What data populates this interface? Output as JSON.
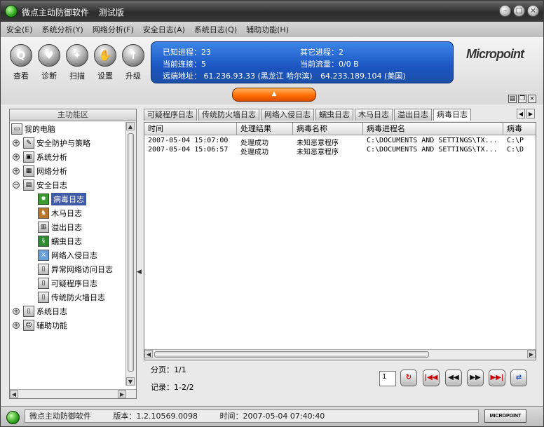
{
  "title": {
    "app": "微点主动防御软件",
    "edition": "测试版"
  },
  "menu": [
    {
      "label": "安全(E)"
    },
    {
      "label": "系统分析(Y)"
    },
    {
      "label": "网络分析(F)"
    },
    {
      "label": "安全日志(A)"
    },
    {
      "label": "系统日志(Q)"
    },
    {
      "label": "辅助功能(H)"
    }
  ],
  "toolbar": [
    {
      "label": "查看",
      "icon": "magnifier-icon",
      "glyph": "Q"
    },
    {
      "label": "诊断",
      "icon": "heart-diagnose-icon",
      "glyph": "♥"
    },
    {
      "label": "扫描",
      "icon": "scan-icon",
      "glyph": "✦"
    },
    {
      "label": "设置",
      "icon": "hand-settings-icon",
      "glyph": "✋"
    },
    {
      "label": "升级",
      "icon": "upgrade-arrow-icon",
      "glyph": "↑"
    }
  ],
  "info": {
    "known_proc": "已知进程：23",
    "other_proc": "其它进程：2",
    "cur_conn": "当前连接：5",
    "cur_flow": "当前流量：0/0 B",
    "remote_label": "远端地址：",
    "remote1": "61.236.93.33 (黑龙江 哈尔滨)",
    "remote2": "64.233.189.104 (美国)"
  },
  "logo": "Micropoint",
  "left_panel": {
    "header": "主功能区",
    "root": "我的电脑",
    "items": [
      {
        "label": "安全防护与策略",
        "toggle": "+"
      },
      {
        "label": "系统分析",
        "toggle": "+"
      },
      {
        "label": "网络分析",
        "toggle": "+"
      },
      {
        "label": "安全日志",
        "toggle": "−"
      },
      {
        "label": "病毒日志"
      },
      {
        "label": "木马日志"
      },
      {
        "label": "溢出日志"
      },
      {
        "label": "蠕虫日志"
      },
      {
        "label": "网络入侵日志"
      },
      {
        "label": "异常网络访问日志"
      },
      {
        "label": "可疑程序日志"
      },
      {
        "label": "传统防火墙日志"
      },
      {
        "label": "系统日志",
        "toggle": "+"
      },
      {
        "label": "辅助功能",
        "toggle": "+"
      }
    ]
  },
  "tabs": [
    {
      "label": "可疑程序日志"
    },
    {
      "label": "传统防火墙日志"
    },
    {
      "label": "网络入侵日志"
    },
    {
      "label": "蠕虫日志"
    },
    {
      "label": "木马日志"
    },
    {
      "label": "溢出日志"
    },
    {
      "label": "病毒日志"
    }
  ],
  "table": {
    "columns": [
      "时间",
      "处理结果",
      "病毒名称",
      "病毒进程名",
      "病毒"
    ],
    "rows": [
      [
        "2007-05-04 15:07:00",
        "处理成功",
        "未知恶意程序",
        "C:\\DOCUMENTS AND SETTINGS\\TX...",
        "C:\\P"
      ],
      [
        "2007-05-04 15:06:57",
        "处理成功",
        "未知恶意程序",
        "C:\\DOCUMENTS AND SETTINGS\\TX...",
        "C:\\D"
      ]
    ]
  },
  "pager": {
    "pages": "分页：1/1",
    "records": "记录：1-2/2",
    "page_input": "1"
  },
  "status": {
    "app": "微点主动防御软件",
    "version": "版本：1.2.10569.0098",
    "time": "时间：2007-05-04 07:40:40",
    "logo": "MICROPOINT"
  },
  "colors": {
    "accent": "#1b55c2",
    "selected": "#3e5aa8",
    "orange": "#ff6a00"
  }
}
